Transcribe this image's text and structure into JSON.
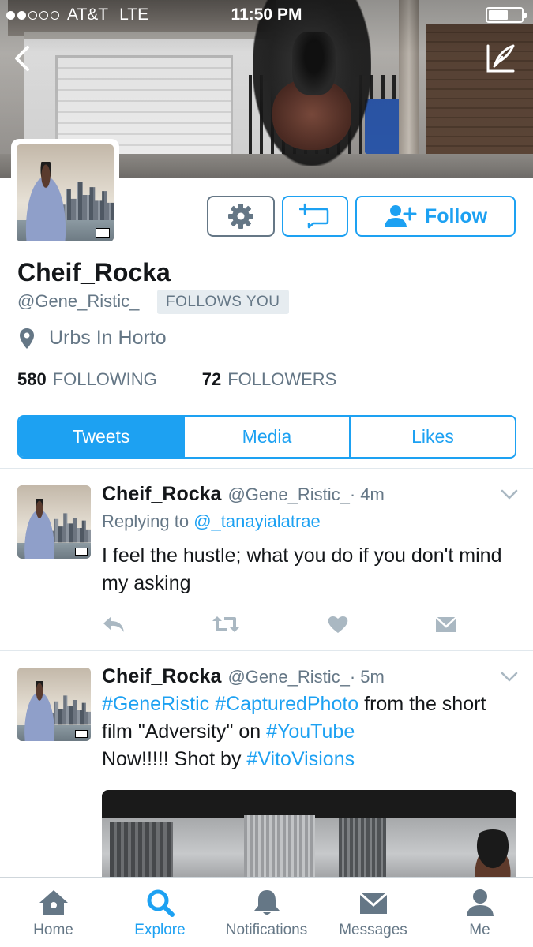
{
  "status_bar": {
    "carrier": "AT&T",
    "network": "LTE",
    "time": "11:50 PM",
    "signal_bars_filled": 2,
    "signal_bars_total": 5,
    "battery_level": 0.5
  },
  "profile": {
    "display_name": "Cheif_Rocka",
    "handle": "@Gene_Ristic_",
    "follows_you_badge": "FOLLOWS YOU",
    "location": "Urbs In Horto",
    "following_count": "580",
    "following_label": "FOLLOWING",
    "followers_count": "72",
    "followers_label": "FOLLOWERS",
    "follow_button_label": "Follow"
  },
  "tabs": [
    {
      "label": "Tweets",
      "active": true
    },
    {
      "label": "Media",
      "active": false
    },
    {
      "label": "Likes",
      "active": false
    }
  ],
  "tweets": [
    {
      "name": "Cheif_Rocka",
      "handle": "@Gene_Ristic_",
      "time": "· 4m",
      "replying_prefix": "Replying to",
      "replying_to": "@_tanayialatrae",
      "text": "I feel the hustle; what you do if you don't mind my asking"
    },
    {
      "name": "Cheif_Rocka",
      "handle": "@Gene_Ristic_",
      "time": "· 5m",
      "text_parts": {
        "tag1": "#GeneRistic",
        "tag2": "#CapturedPhoto",
        "t1": " from the short film \"Adversity\" on ",
        "tag3": "#YouTube",
        "t2": " Now!!!!! Shot by ",
        "tag4": "#VitoVisions"
      }
    }
  ],
  "tab_bar": [
    {
      "label": "Home",
      "icon": "home-icon",
      "active": false
    },
    {
      "label": "Explore",
      "icon": "search-icon",
      "active": true
    },
    {
      "label": "Notifications",
      "icon": "bell-icon",
      "active": false
    },
    {
      "label": "Messages",
      "icon": "envelope-icon",
      "active": false
    },
    {
      "label": "Me",
      "icon": "person-icon",
      "active": false
    }
  ],
  "colors": {
    "accent": "#1da1f2",
    "secondary_text": "#657786",
    "primary_text": "#14171a",
    "badge_bg": "#e6ecf0"
  }
}
